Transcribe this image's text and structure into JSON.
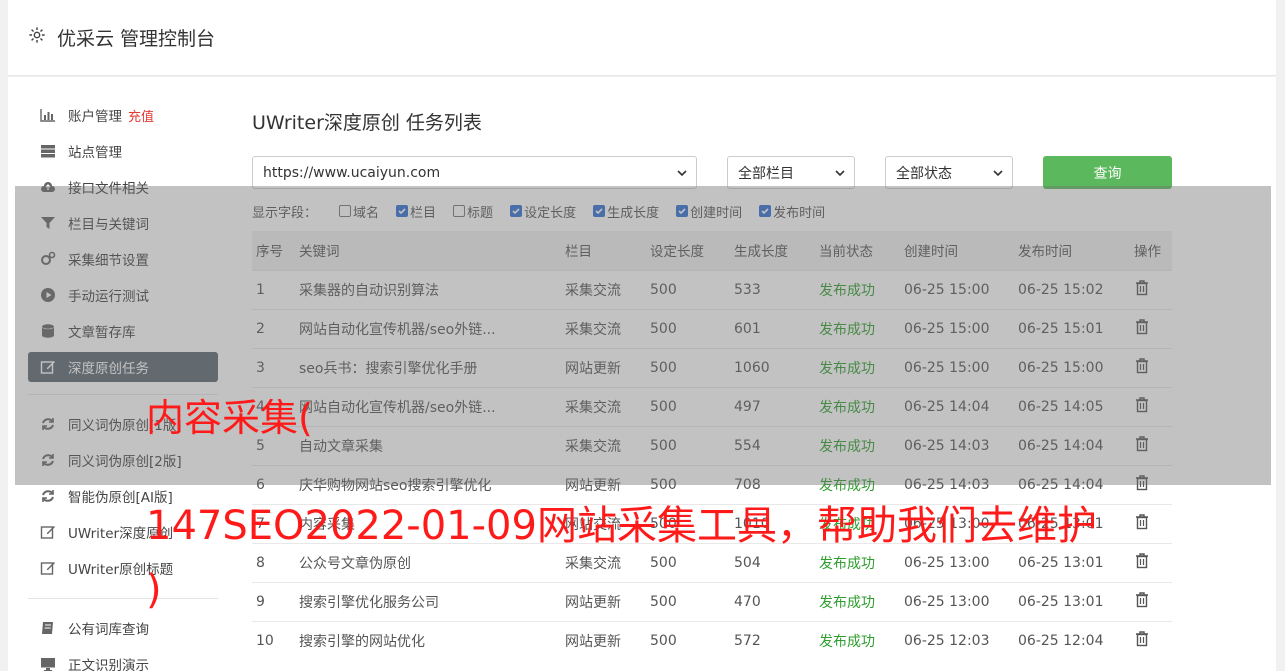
{
  "header": {
    "title": "优采云 管理控制台",
    "icon": "gear-icon"
  },
  "sidebar": {
    "items": [
      {
        "label": "账户管理",
        "badge": "充值",
        "icon": "bar-chart-icon"
      },
      {
        "label": "站点管理",
        "icon": "server-icon"
      },
      {
        "label": "接口文件相关",
        "icon": "cloud-upload-icon"
      },
      {
        "label": "栏目与关键词",
        "icon": "filter-icon"
      },
      {
        "label": "采集细节设置",
        "icon": "cogs-icon"
      },
      {
        "label": "手动运行测试",
        "icon": "play-circle-icon"
      },
      {
        "label": "文章暂存库",
        "icon": "database-icon"
      },
      {
        "label": "深度原创任务",
        "icon": "edit-icon",
        "active": true
      },
      {
        "label": "同义词伪原创[1版]",
        "icon": "refresh-icon"
      },
      {
        "label": "同义词伪原创[2版]",
        "icon": "refresh-icon"
      },
      {
        "label": "智能伪原创[AI版]",
        "icon": "refresh-icon"
      },
      {
        "label": "UWriter深度原创",
        "icon": "edit-icon"
      },
      {
        "label": "UWriter原创标题",
        "icon": "edit-icon"
      },
      {
        "label": "公有词库查询",
        "icon": "book-icon"
      },
      {
        "label": "正文识别演示",
        "icon": "monitor-icon"
      }
    ]
  },
  "main": {
    "title": "UWriter深度原创 任务列表",
    "site_select": "https://www.ucaiyun.com",
    "column_select": "全部栏目",
    "status_select": "全部状态",
    "query_button": "查询",
    "fields_label": "显示字段：",
    "fields": [
      {
        "label": "域名",
        "checked": false
      },
      {
        "label": "栏目",
        "checked": true
      },
      {
        "label": "标题",
        "checked": false
      },
      {
        "label": "设定长度",
        "checked": true
      },
      {
        "label": "生成长度",
        "checked": true
      },
      {
        "label": "创建时间",
        "checked": true
      },
      {
        "label": "发布时间",
        "checked": true
      }
    ],
    "table": {
      "headers": [
        "序号",
        "关键词",
        "栏目",
        "设定长度",
        "生成长度",
        "当前状态",
        "创建时间",
        "发布时间",
        "操作"
      ],
      "rows": [
        [
          "1",
          "采集器的自动识别算法",
          "采集交流",
          "500",
          "533",
          "发布成功",
          "06-25 15:00",
          "06-25 15:02"
        ],
        [
          "2",
          "网站自动化宣传机器/seo外链...",
          "采集交流",
          "500",
          "601",
          "发布成功",
          "06-25 15:00",
          "06-25 15:01"
        ],
        [
          "3",
          "seo兵书：搜索引擎优化手册",
          "网站更新",
          "500",
          "1060",
          "发布成功",
          "06-25 15:00",
          "06-25 15:00"
        ],
        [
          "4",
          "网站自动化宣传机器/seo外链...",
          "采集交流",
          "500",
          "497",
          "发布成功",
          "06-25 14:04",
          "06-25 14:05"
        ],
        [
          "5",
          "自动文章采集",
          "采集交流",
          "500",
          "554",
          "发布成功",
          "06-25 14:03",
          "06-25 14:04"
        ],
        [
          "6",
          "庆华购物网站seo搜索引擎优化",
          "网站更新",
          "500",
          "708",
          "发布成功",
          "06-25 14:03",
          "06-25 14:04"
        ],
        [
          "7",
          "内容采集",
          "网站交流",
          "500",
          "1010",
          "发布成功",
          "06-25 13:00",
          "06-25 13:01"
        ],
        [
          "8",
          "公众号文章伪原创",
          "采集交流",
          "500",
          "504",
          "发布成功",
          "06-25 13:00",
          "06-25 13:01"
        ],
        [
          "9",
          "搜索引擎优化服务公司",
          "网站更新",
          "500",
          "470",
          "发布成功",
          "06-25 13:00",
          "06-25 13:01"
        ],
        [
          "10",
          "搜索引擎的网站优化",
          "网站更新",
          "500",
          "572",
          "发布成功",
          "06-25 12:03",
          "06-25 12:04"
        ]
      ]
    }
  },
  "watermark": {
    "line1": "内容采集(",
    "line2": "147SEO2022-01-09网站采集工具，帮助我们去维护",
    "line3": ")"
  },
  "colors": {
    "accent": "#5cb85c",
    "status": "#2e9e2e",
    "active_nav": "#5b6770",
    "watermark": "#ff1a1a",
    "recharge": "#e53935"
  }
}
